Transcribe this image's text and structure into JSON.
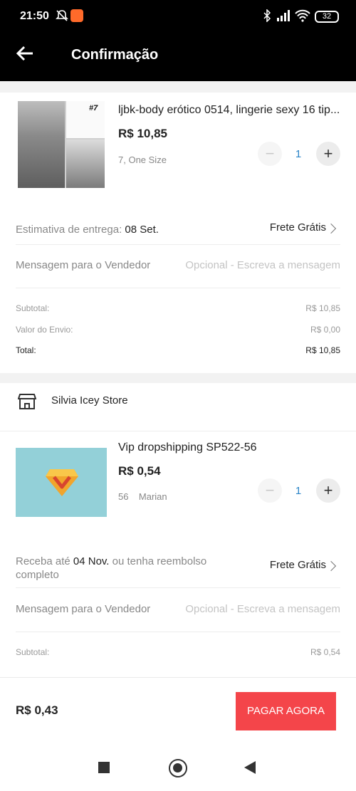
{
  "status": {
    "time": "21:50",
    "battery": "32",
    "icons": [
      "mute-bell-icon",
      "app-notification-icon",
      "bluetooth-icon",
      "signal-icon",
      "wifi-icon",
      "battery-icon"
    ]
  },
  "header": {
    "back_icon": "arrow-left-icon",
    "title": "Confirmação"
  },
  "order1": {
    "product": {
      "name": "ljbk-body erótico 0514, lingerie sexy 16 tip...",
      "image_tag": "#7",
      "price": "R$ 10,85",
      "variant": "7,  One Size",
      "qty": "1",
      "minus": "−",
      "plus": "+"
    },
    "delivery": {
      "label": "Estimativa de entrega: ",
      "date": "08 Set.",
      "shipping": "Frete Grátis"
    },
    "message": {
      "label": "Mensagem para o Vendedor",
      "placeholder": "Opcional - Escreva a mensagem"
    },
    "summary": {
      "subtotal_label": "Subtotal:",
      "subtotal": "R$ 10,85",
      "shipping_label": "Valor do Envio:",
      "shipping": "R$ 0,00",
      "total_label": "Total:",
      "total": "R$ 10,85"
    }
  },
  "order2": {
    "store": {
      "icon": "store-icon",
      "name": "Silvia Icey Store"
    },
    "product": {
      "name": "Vip dropshipping SP522-56",
      "price": "R$ 0,54",
      "variant": "56    Marian",
      "qty": "1",
      "minus": "−",
      "plus": "+"
    },
    "delivery": {
      "prefix": "Receba até ",
      "date": "04 Nov.",
      "suffix_line1": " ou tenha reembolso",
      "suffix_line2": "completo",
      "shipping": "Frete Grátis"
    },
    "message": {
      "label": "Mensagem para o Vendedor",
      "placeholder": "Opcional - Escreva a mensagem"
    },
    "summary": {
      "subtotal_label": "Subtotal:",
      "subtotal": "R$ 0,54"
    }
  },
  "footer": {
    "total": "R$ 0,43",
    "pay_label": "PAGAR AGORA"
  },
  "colors": {
    "accent": "#f4454a",
    "qty": "#2a84c7",
    "header": "#000000",
    "vip_bg": "#93d0d8"
  }
}
